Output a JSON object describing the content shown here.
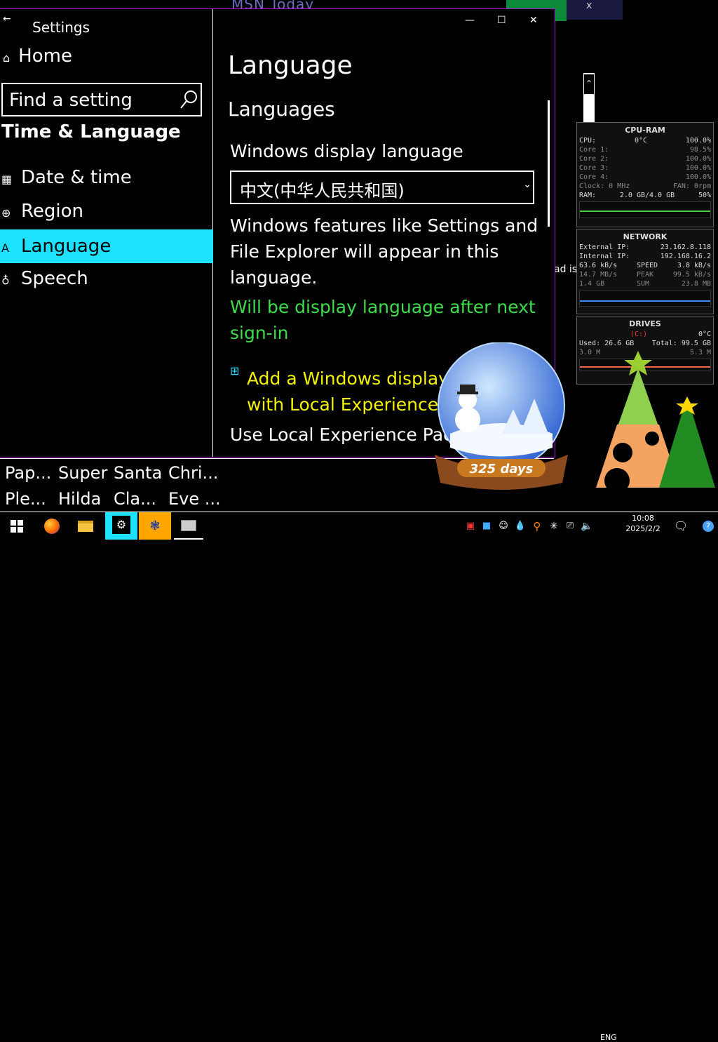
{
  "background_app": {
    "title": "MSN Today",
    "close_glyph": "x"
  },
  "settings": {
    "back_glyph": "←",
    "app_title": "Settings",
    "home_label": "Home",
    "search_placeholder": "Find a setting",
    "category": "Time & Language",
    "nav": [
      {
        "label": "Date & time",
        "icon": "calendar-clock-icon",
        "selected": false
      },
      {
        "label": "Region",
        "icon": "globe-icon",
        "selected": false
      },
      {
        "label": "Language",
        "icon": "language-icon",
        "selected": true
      },
      {
        "label": "Speech",
        "icon": "microphone-icon",
        "selected": false
      }
    ],
    "window_controls": {
      "minimize": "—",
      "maximize": "☐",
      "close": "✕"
    },
    "page_title": "Language",
    "section_title": "Languages",
    "display_language_label": "Windows display language",
    "display_language_value": "中文(中华人民共和国)",
    "description": "Windows features like Settings and File Explorer will appear in this language.",
    "pending_notice": "Will be display language after next sign-in",
    "add_link": "Add a Windows display language with Local Experience Packs",
    "use_text": "Use Local Experience Packs"
  },
  "bookmarks": [
    {
      "line1": "Pap...",
      "line2": "Ple..."
    },
    {
      "line1": "Super",
      "line2": "Hilda"
    },
    {
      "line1": "Santa",
      "line2": "Cla..."
    },
    {
      "line1": "Chri...",
      "line2": "Eve ..."
    }
  ],
  "stray_text": "ad is",
  "widgets": {
    "cpu_ram": {
      "title": "CPU-RAM",
      "cpu_label": "CPU:",
      "cpu_temp": "0°C",
      "cpu_pct": "100.0%",
      "cores": [
        {
          "label": "Core 1:",
          "value": "98.5%"
        },
        {
          "label": "Core 2:",
          "value": "100.0%"
        },
        {
          "label": "Core 3:",
          "value": "100.0%"
        },
        {
          "label": "Core 4:",
          "value": "100.0%"
        }
      ],
      "clock": "Clock: 0 MHz",
      "fan": "FAN: 0rpm",
      "ram_label": "RAM:",
      "ram_value": "2.0 GB/4.0 GB",
      "ram_pct": "50%"
    },
    "network": {
      "title": "NETWORK",
      "external_label": "External IP:",
      "external_ip": "23.162.8.118",
      "internal_label": "Internal IP:",
      "internal_ip": "192.168.16.2",
      "down_speed": "63.6 kB/s",
      "speed_label": "SPEED",
      "up_speed": "3.8 kB/s",
      "down_peak": "14.7 MB/s",
      "peak_label": "PEAK",
      "up_peak": "99.5 kB/s",
      "down_sum": "1.4 GB",
      "sum_label": "SUM",
      "up_sum": "23.8 MB"
    },
    "drives": {
      "title": "DRIVES",
      "drive": "(C:)",
      "temp": "0°C",
      "used": "Used: 26.6 GB",
      "total": "Total: 99.5 GB",
      "read": "3.0 M",
      "write": "5.3 M"
    }
  },
  "globe": {
    "days_text": "325 days"
  },
  "taskbar": {
    "lang": "ENG",
    "time": "10:08",
    "date": "2025/2/2",
    "colors": {
      "settings_active": "#1ee0ff",
      "active_app": "#ffa500"
    }
  }
}
